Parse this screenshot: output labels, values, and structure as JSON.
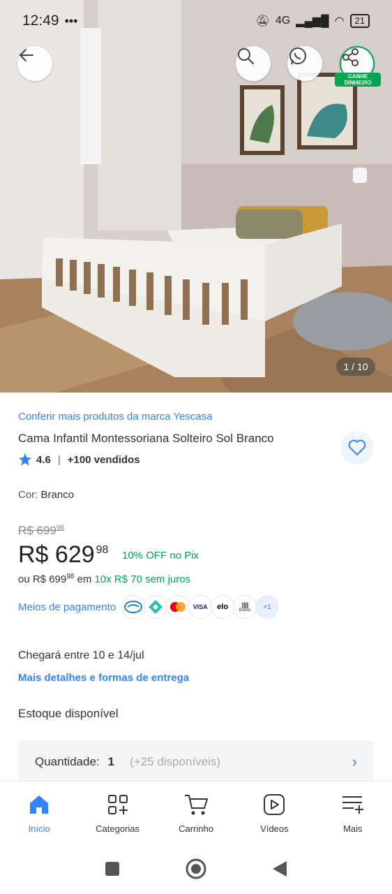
{
  "status_bar": {
    "time": "12:49",
    "extra": "•••",
    "network": "4G",
    "battery": "21"
  },
  "hero": {
    "counter": "1 / 10",
    "earn_badge": "GANHE DINHEIRO"
  },
  "product": {
    "brand_link": "Conferir mais produtos da marca Yescasa",
    "title": "Cama Infantil Montessoriana Solteiro Sol Branco",
    "rating": "4.6",
    "sold": "+100 vendidos",
    "color_label": "Cor:",
    "color_value": "Branco",
    "old_price_main": "R$ 699",
    "old_price_cents": "98",
    "price_main": "R$ 629",
    "price_cents": "98",
    "pix_offer": "10% OFF no Pix",
    "install_prefix": "ou R$ 699",
    "install_cents": "98",
    "install_mid": " em ",
    "install_green": "10x R$ 70 sem juros",
    "payment_link": "Meios de pagamento",
    "payment_more": "+1",
    "payment_visa": "VISA",
    "payment_elo": "elo",
    "payment_boleto": "Boleto",
    "delivery": "Chegará entre 10 e 14/jul",
    "delivery_link": "Mais detalhes e formas de entrega",
    "stock": "Estoque disponível",
    "qty_label": "Quantidade:",
    "qty_value": "1",
    "qty_available": "(+25 disponíveis)"
  },
  "nav": {
    "items": [
      {
        "label": "Início",
        "icon": "home-icon"
      },
      {
        "label": "Categorias",
        "icon": "categories-icon"
      },
      {
        "label": "Carrinho",
        "icon": "cart-icon"
      },
      {
        "label": "Vídeos",
        "icon": "video-icon"
      },
      {
        "label": "Mais",
        "icon": "more-icon"
      }
    ]
  },
  "colors": {
    "link": "#3483fa",
    "green": "#00a650",
    "text": "#333333"
  }
}
